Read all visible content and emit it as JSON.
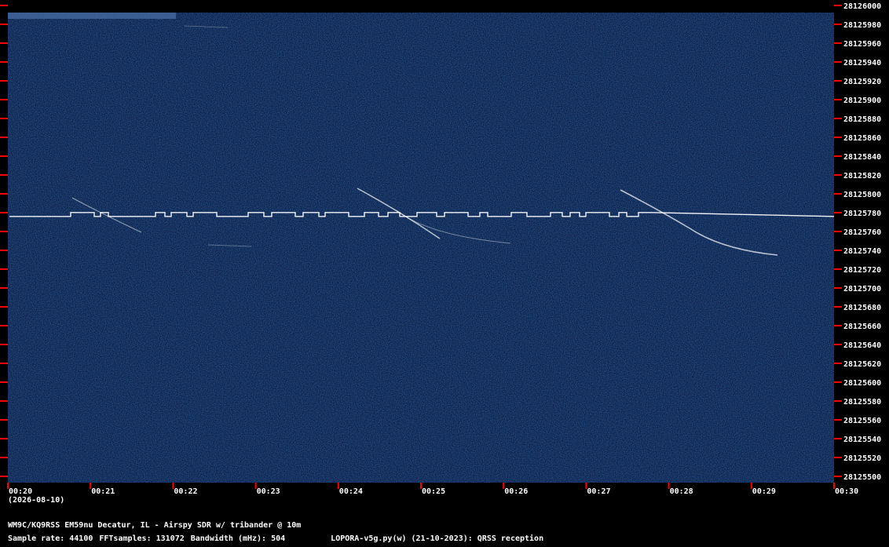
{
  "chart_data": {
    "type": "heatmap",
    "title": "",
    "xlabel": "",
    "ylabel": "",
    "x_ticks": [
      "00:20",
      "00:21",
      "00:22",
      "00:23",
      "00:24",
      "00:25",
      "00:26",
      "00:27",
      "00:28",
      "00:29",
      "00:30"
    ],
    "x_date": "(2026-08-10)",
    "ylim": [
      28125500,
      28126000
    ],
    "y_ticks": [
      28126000,
      28125980,
      28125960,
      28125940,
      28125920,
      28125900,
      28125880,
      28125860,
      28125840,
      28125820,
      28125800,
      28125780,
      28125760,
      28125740,
      28125720,
      28125700,
      28125680,
      28125660,
      28125640,
      28125620,
      28125600,
      28125580,
      28125560,
      28125540,
      28125520,
      28125500
    ],
    "carrier_hz": 28125776,
    "colors": {
      "background": "#0a1e47",
      "signal": "#ffffff",
      "tick": "#ff0000"
    }
  },
  "footer": {
    "station": "WM9C/KQ9RSS EM59nu Decatur, IL - Airspy SDR w/ tribander @ 10m",
    "sample_rate": "Sample rate: 44100",
    "fft": "FFTsamples: 131072",
    "bandwidth": "Bandwidth (mHz): 504",
    "software": "LOPORA-v5g.py(w) (21-10-2023): QRSS reception"
  }
}
